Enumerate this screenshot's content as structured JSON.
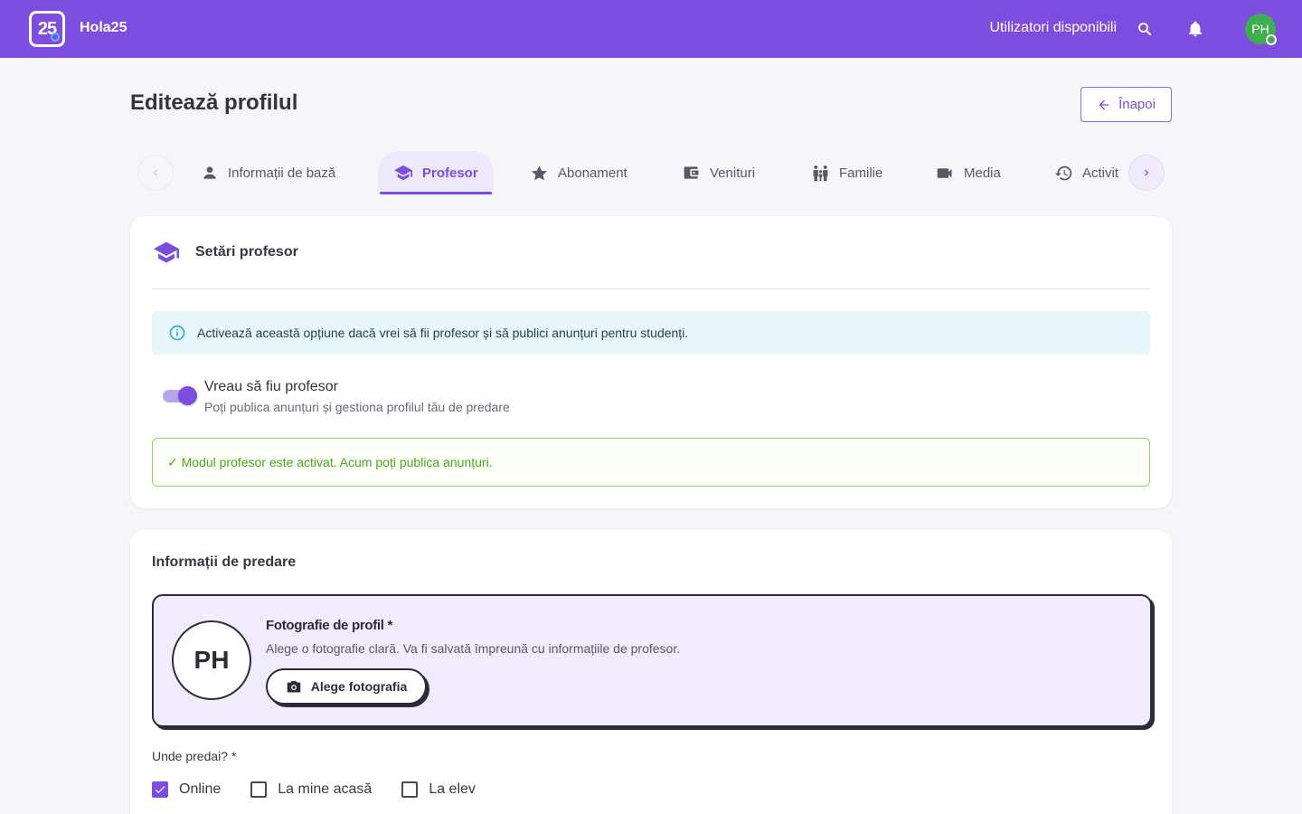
{
  "app": {
    "logo_text": "25",
    "brand": "Hola25",
    "online_users": "Utilizatori disponibili",
    "avatar_initials": "PH"
  },
  "header": {
    "title": "Editează profilul",
    "back_label": "Înapoi"
  },
  "tabs": [
    {
      "label": "Informații de bază",
      "icon": "person-icon"
    },
    {
      "label": "Profesor",
      "icon": "graduation-cap-icon",
      "active": true
    },
    {
      "label": "Abonament",
      "icon": "star-icon"
    },
    {
      "label": "Venituri",
      "icon": "wallet-icon"
    },
    {
      "label": "Familie",
      "icon": "family-icon"
    },
    {
      "label": "Media",
      "icon": "video-camera-icon"
    },
    {
      "label": "Activit",
      "icon": "history-icon"
    }
  ],
  "teacher_settings": {
    "title": "Setări profesor",
    "info": "Activează această opțiune dacă vrei să fii profesor și să publici anunțuri pentru studenți.",
    "toggle_label": "Vreau să fiu profesor",
    "toggle_sub": "Poți publica anunțuri și gestiona profilul tău de predare",
    "toggle_on": true,
    "success": "✓ Modul profesor este activat. Acum poți publica anunțuri."
  },
  "teaching_info": {
    "title": "Informații de predare",
    "photo_initials": "PH",
    "photo_title": "Fotografie de profil *",
    "photo_desc": "Alege o fotografie clară. Va fi salvată împreună cu informațiile de profesor.",
    "photo_button": "Alege fotografia",
    "where_label": "Unde predai? *",
    "options": [
      {
        "label": "Online",
        "checked": true
      },
      {
        "label": "La mine acasă",
        "checked": false
      },
      {
        "label": "La elev",
        "checked": false
      }
    ]
  },
  "colors": {
    "primary": "#7c4ddf",
    "success": "#4ea41c",
    "info_bg": "#e8f6fc"
  }
}
